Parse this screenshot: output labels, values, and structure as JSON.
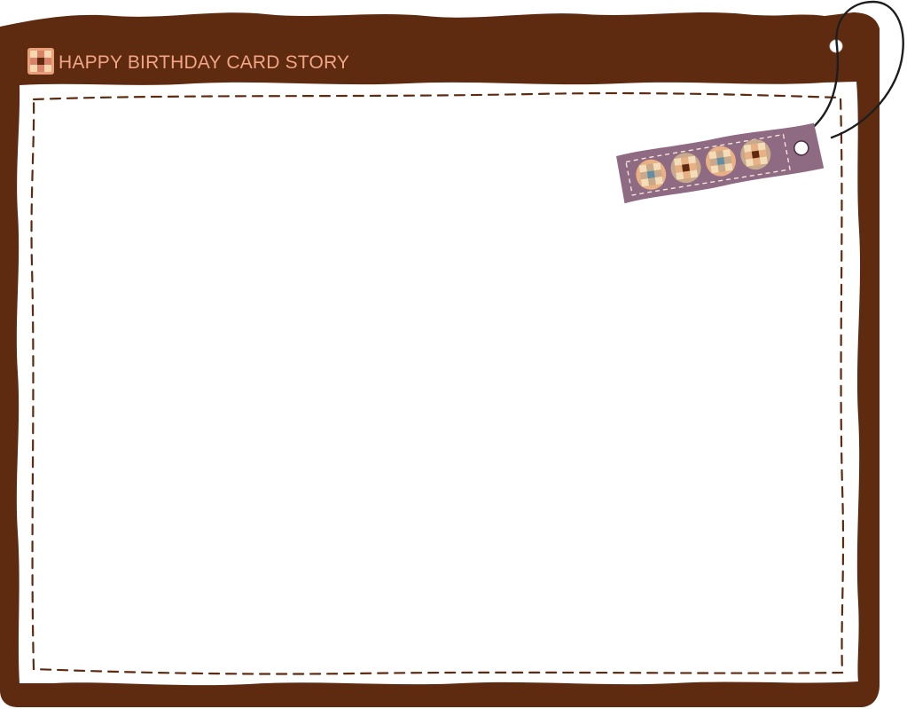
{
  "card": {
    "title": "HAPPY BIRTHDAY CARD STORY"
  },
  "colors": {
    "frame": "#5e2b11",
    "title_text": "#f2a484",
    "stitch": "#5e2b11",
    "paper": "#ffffff",
    "tag_fill": "#8f6a83",
    "tag_stitch": "#f4e6d8",
    "flower_peach": "#e9b083",
    "flower_tan": "#c9a98b",
    "flower_cream": "#f3ddb8",
    "flower_blue": "#5f8fa6",
    "flower_brown": "#5e2b11",
    "cord": "#1e1e1e"
  },
  "icons": {
    "logo": "checker-square-icon",
    "tag": "gift-tag-icon",
    "hole": "eyelet-hole-icon"
  }
}
